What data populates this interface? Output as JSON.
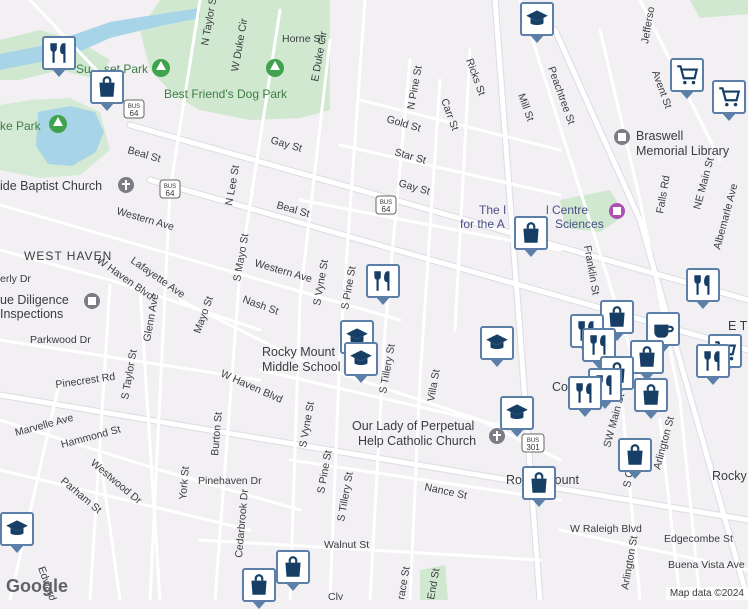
{
  "areas": {
    "parks": [
      "Sunset Park",
      "Best Friend's Dog Park",
      "Lake Park"
    ],
    "neighborhood": "WEST HAVEN",
    "pois": [
      "Braswell Memorial Library",
      "The Imperial Centre for the Arts & Sciences",
      "Rocky Mount Middle School",
      "Our Lady of Perpetual Help Catholic Church",
      "Due Diligence Inspections",
      "Baptist Church"
    ]
  },
  "labels": {
    "n_taylor": "N Taylor St",
    "horne": "Horne St",
    "w_duke": "W Duke Cir",
    "e_duke": "E Duke Cir",
    "sunset_park_a": "Su",
    "sunset_park_b": "set Park",
    "dog_park": "Best Friend's Dog Park",
    "lake_park": "ke Park",
    "baptist": "ide Baptist Church",
    "beal_w": "Beal St",
    "beal_e": "Beal St",
    "gay_w": "Gay St",
    "gay_e": "Gay St",
    "gold": "Gold St",
    "star": "Star St",
    "n_pine": "N Pine St",
    "carr": "Carr St",
    "ricks": "Ricks St",
    "mill": "Mill St",
    "peachtree": "Peachtree St",
    "jefferson": "Jefferso",
    "avent": "Avent St",
    "braswell_1": "Braswell",
    "braswell_2": "Memorial Library",
    "imperial_1": "The I",
    "imperial_1b": "l Centre",
    "imperial_2": "for the A",
    "imperial_2b": "Sciences",
    "franklin": "Franklin St",
    "falls": "Falls Rd",
    "ne_main": "NE Main St",
    "albemarle": "Albemarle Ave",
    "e_t": "E T",
    "n_lee": "N Lee St",
    "western_w": "Western Ave",
    "western_c": "Western Ave",
    "west_haven": "WEST HAVEN",
    "erly": "erly Dr",
    "lafayette": "Lafayette Ave",
    "s_mayo": "S Mayo St",
    "s_vyne_n": "S Vyne St",
    "s_pine_n": "S Pine St",
    "nash": "Nash St",
    "w_haven_blvd_n": "W Haven Blvd",
    "glenn": "Glenn Ave",
    "mayo": "Mayo St",
    "due_1": "ue Diligence",
    "due_2": "Inspections",
    "parkwood": "Parkwood Dr",
    "school_1": "Rocky Mount",
    "school_2": "Middle School",
    "s_tillery_n": "S Tillery St",
    "villa": "Villa St",
    "pinecrest": "Pinecrest Rd",
    "s_taylor": "S Taylor St",
    "w_haven_blvd_s": "W Haven Blvd",
    "marvelle": "Marvelle Ave",
    "hammond": "Hammond St",
    "westwood": "Westwood Dr",
    "burton": "Burton St",
    "york": "York St",
    "parham": "Parham St",
    "pinehaven": "Pinehaven Dr",
    "cedarbrook": "Cedarbrook Dr",
    "s_vyne_s": "S Vyne St",
    "s_pine_s": "S Pine St",
    "s_tillery_s": "S Tillery St",
    "church_1": "Our Lady of Perpetual",
    "church_2": "Help Catholic Church",
    "nance": "Nance St",
    "rocky_mount": "Rocky Mount",
    "w_raleigh": "W Raleigh Blvd",
    "edgecombe": "Edgecombe St",
    "buena_vista": "Buena Vista Ave",
    "walnut": "Walnut St",
    "edwards": "Edwards St",
    "arlington_e": "Arlington St",
    "arlington_s": "Arlington St",
    "sw_main": "SW Main St",
    "s_ch": "S Ch",
    "co": "Co",
    "rocky_e": "Rocky",
    "race": "race St",
    "end": "End St",
    "cly": "Cly",
    "bus_64_1": "BUS",
    "bus_64_1n": "64",
    "bus_64_2": "BUS",
    "bus_64_2n": "64",
    "bus_64_3": "BUS",
    "bus_64_3n": "64",
    "bus_301": "BUS",
    "bus_301n": "301"
  },
  "attribution": {
    "google": "Google",
    "map_data": "Map data ©2024"
  },
  "colors": {
    "road": "#ffffff",
    "road_edge": "#d9d9e0",
    "main_road": "#e7e6ec",
    "park": "#c8e6c9",
    "water": "#a3d2e6",
    "marker_border": "#5b7fa8",
    "marker_icon": "#173f66"
  }
}
